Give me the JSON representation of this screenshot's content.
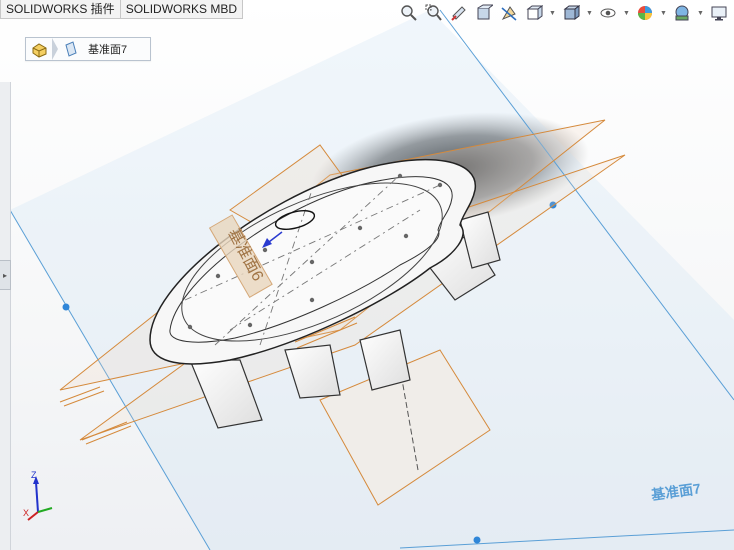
{
  "tabs": [
    {
      "label": "SOLIDWORKS 插件"
    },
    {
      "label": "SOLIDWORKS MBD"
    }
  ],
  "toolbar": {
    "icons": [
      "zoom-to-fit-icon",
      "zoom-to-area-icon",
      "previous-view-icon",
      "section-view-icon",
      "dynamic-annotation-icon",
      "view-orientation-icon",
      "display-style-icon",
      "hide-show-items-icon",
      "edit-appearance-icon",
      "apply-scene-icon",
      "view-settings-icon"
    ]
  },
  "breadcrumb": {
    "label": "基准面7"
  },
  "model": {
    "plane_label_front": "基准面7",
    "plane_label_small": "基准面6"
  },
  "triad": {
    "z": "Z",
    "x": "X"
  },
  "colors": {
    "plane_blue": "#5a9fd6",
    "plane_orange": "#d58a3c",
    "highlight_handle": "#2f86d8",
    "body_fill": "#f7f7f7"
  }
}
